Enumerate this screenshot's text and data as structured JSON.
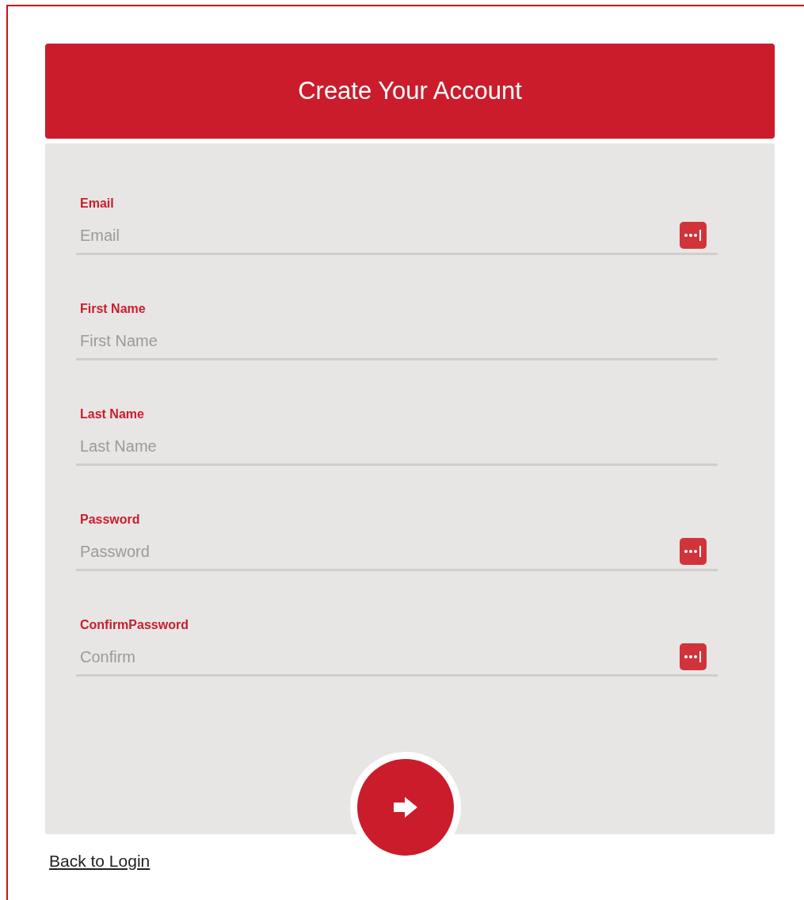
{
  "header": {
    "title": "Create Your Account"
  },
  "fields": [
    {
      "label": "Email",
      "placeholder": "Email",
      "has_icon": true
    },
    {
      "label": "First Name",
      "placeholder": "First Name",
      "has_icon": false
    },
    {
      "label": "Last Name",
      "placeholder": "Last Name",
      "has_icon": false
    },
    {
      "label": "Password",
      "placeholder": "Password",
      "has_icon": true
    },
    {
      "label": "ConfirmPassword",
      "placeholder": "Confirm",
      "has_icon": true
    }
  ],
  "back_link": "Back to Login"
}
